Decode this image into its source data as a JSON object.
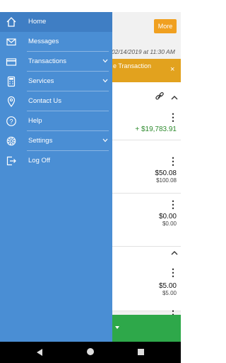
{
  "background": {
    "more_label": "More",
    "timestamp": "02/14/2019 at 11:30 AM",
    "banner_text": "e Transaction",
    "banner_close": "×",
    "card1": {
      "kebab": "⋮",
      "amount": "+ $19,783.91"
    },
    "card2": {
      "kebab": "⋮",
      "amount": "$50.08",
      "sub_amount": "$100.08"
    },
    "card3": {
      "kebab": "⋮",
      "amount": "$0.00",
      "sub_amount": "$0.00"
    },
    "card4": {
      "kebab": "⋮",
      "amount": "$5.00",
      "sub_amount": "$5.00"
    },
    "card5": {
      "kebab": "⋮"
    }
  },
  "drawer": {
    "items": [
      {
        "label": "Home",
        "icon": "home-icon",
        "expandable": false
      },
      {
        "label": "Messages",
        "icon": "envelope-icon",
        "expandable": false
      },
      {
        "label": "Transactions",
        "icon": "credit-card-icon",
        "expandable": true
      },
      {
        "label": "Services",
        "icon": "calculator-icon",
        "expandable": true
      },
      {
        "label": "Contact Us",
        "icon": "location-pin-icon",
        "expandable": false
      },
      {
        "label": "Help",
        "icon": "help-icon",
        "expandable": false
      },
      {
        "label": "Settings",
        "icon": "gear-icon",
        "expandable": true
      },
      {
        "label": "Log Off",
        "icon": "logout-icon",
        "expandable": false
      }
    ]
  },
  "colors": {
    "drawer_bg": "#4a8ed4",
    "drawer_selected": "#3f7ec4",
    "accent_orange": "#f0a020",
    "positive_green": "#2e8b2e"
  }
}
